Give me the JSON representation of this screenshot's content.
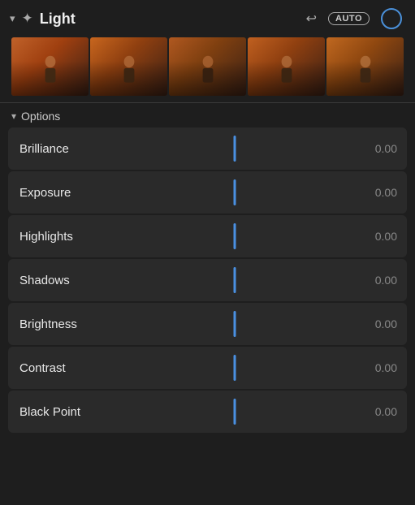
{
  "header": {
    "title": "Light",
    "auto_label": "AUTO",
    "chevron": "▾",
    "sun_symbol": "☀"
  },
  "options": {
    "label": "Options",
    "chevron": "▾"
  },
  "sliders": [
    {
      "id": "brilliance",
      "label": "Brilliance",
      "value": "0.00"
    },
    {
      "id": "exposure",
      "label": "Exposure",
      "value": "0.00"
    },
    {
      "id": "highlights",
      "label": "Highlights",
      "value": "0.00"
    },
    {
      "id": "shadows",
      "label": "Shadows",
      "value": "0.00"
    },
    {
      "id": "brightness",
      "label": "Brightness",
      "value": "0.00"
    },
    {
      "id": "contrast",
      "label": "Contrast",
      "value": "0.00"
    },
    {
      "id": "blackpoint",
      "label": "Black Point",
      "value": "0.00"
    }
  ],
  "thumbnails": [
    {
      "id": "thumb-1",
      "class": "thumb-1"
    },
    {
      "id": "thumb-2",
      "class": "thumb-2"
    },
    {
      "id": "thumb-3",
      "class": "thumb-3"
    },
    {
      "id": "thumb-4",
      "class": "thumb-4"
    },
    {
      "id": "thumb-5",
      "class": "thumb-5"
    }
  ],
  "colors": {
    "accent_blue": "#4a90e2",
    "bg": "#1e1e1e",
    "row_bg": "#2a2a2a"
  }
}
